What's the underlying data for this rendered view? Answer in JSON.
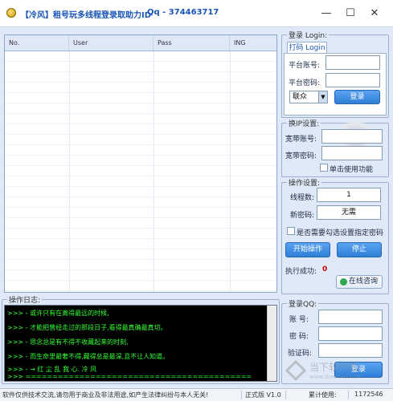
{
  "titlebar": {
    "title": "【冷风】租号玩多线程登录取助力ID",
    "qq": "Qq - 374463717",
    "minimize": "—",
    "maximize": "☐",
    "close": "✕"
  },
  "account_list": {
    "columns": [
      "No.",
      "User",
      "Pass",
      "ING"
    ]
  },
  "login": {
    "group_title": "登录 Login:",
    "tab_label": "打码 Login",
    "platform_account_label": "平台账号:",
    "platform_account_value": "",
    "platform_password_label": "平台密码:",
    "platform_password_value": "",
    "select_value": "联众",
    "login_button": "登录"
  },
  "ip_settings": {
    "group_title": "换IP设置:",
    "broadband_account_label": "宽带账号:",
    "broadband_account_value": "",
    "broadband_password_label": "宽带密码:",
    "broadband_password_value": "",
    "single_use_label": "单击使用功能",
    "single_use_checked": false
  },
  "operation": {
    "group_title": "操作设置:",
    "threads_label": "线程数:",
    "threads_value": "1",
    "new_password_label": "新密码:",
    "new_password_value": "无需",
    "require_password_label": "是否需要勾选设置指定密码",
    "require_password_checked": false,
    "start_button": "开始操作",
    "stop_button": "停止",
    "success_label": "执行成功:",
    "success_count": "0",
    "consult_button": "在线咨询"
  },
  "log": {
    "group_title": "操作日志:",
    "lines": [
      ">>> - 或许只有在离得最远的时候,",
      ">>> - 才能把曾经走过的那段日子,看得最真确最真切。",
      ">>> - 思念总是有不得不收藏起来的时刻,",
      ">>> - 而生命里最奢不得,藏得总是最深,且不让人知道。",
      ">>> - → 红 尘 乱 我 心. 冷 风",
      ">>> =========================================="
    ]
  },
  "login_qq": {
    "group_title": "登录QQ:",
    "account_label": "账 号:",
    "account_value": "",
    "password_label": "密 码:",
    "password_value": "",
    "captcha_label": "验证码:",
    "captcha_value": "",
    "login_button": "登录"
  },
  "watermark": {
    "text": "当下软件园",
    "url": "www.downxia.com"
  },
  "statusbar": {
    "disclaimer": "软件仅供技术交流,请勿用于商业及非法用途,如产生法律纠纷与本人无关!",
    "version": "正式版 V1.0",
    "usage_label": "累计使用:",
    "usage_count": "1172546"
  },
  "colors": {
    "accent": "#2f7fd8",
    "title_text": "#1a55b8",
    "log_text": "#33ff33",
    "success_count": "#d00000"
  }
}
